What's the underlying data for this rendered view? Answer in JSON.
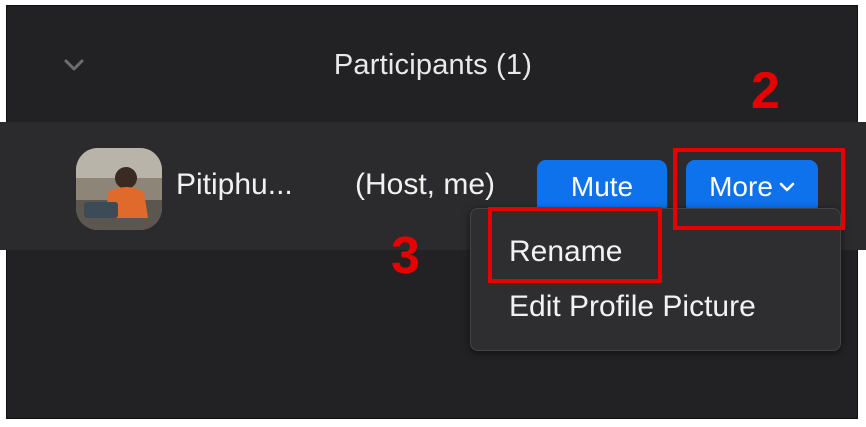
{
  "panel": {
    "title": "Participants (1)",
    "collapse_icon": "chevron-down-icon"
  },
  "participant": {
    "name": "Pitiphu...",
    "role": "(Host, me)",
    "mute_label": "Mute",
    "more_label": "More",
    "more_icon": "chevron-down-icon"
  },
  "menu": {
    "items": [
      {
        "label": "Rename"
      },
      {
        "label": "Edit Profile Picture"
      }
    ]
  },
  "annotations": {
    "step_more": "2",
    "step_rename": "3",
    "highlight_color": "#e60000"
  },
  "colors": {
    "panel_bg": "#222224",
    "row_bg": "#2b2b2d",
    "button_blue": "#0e72ed"
  }
}
